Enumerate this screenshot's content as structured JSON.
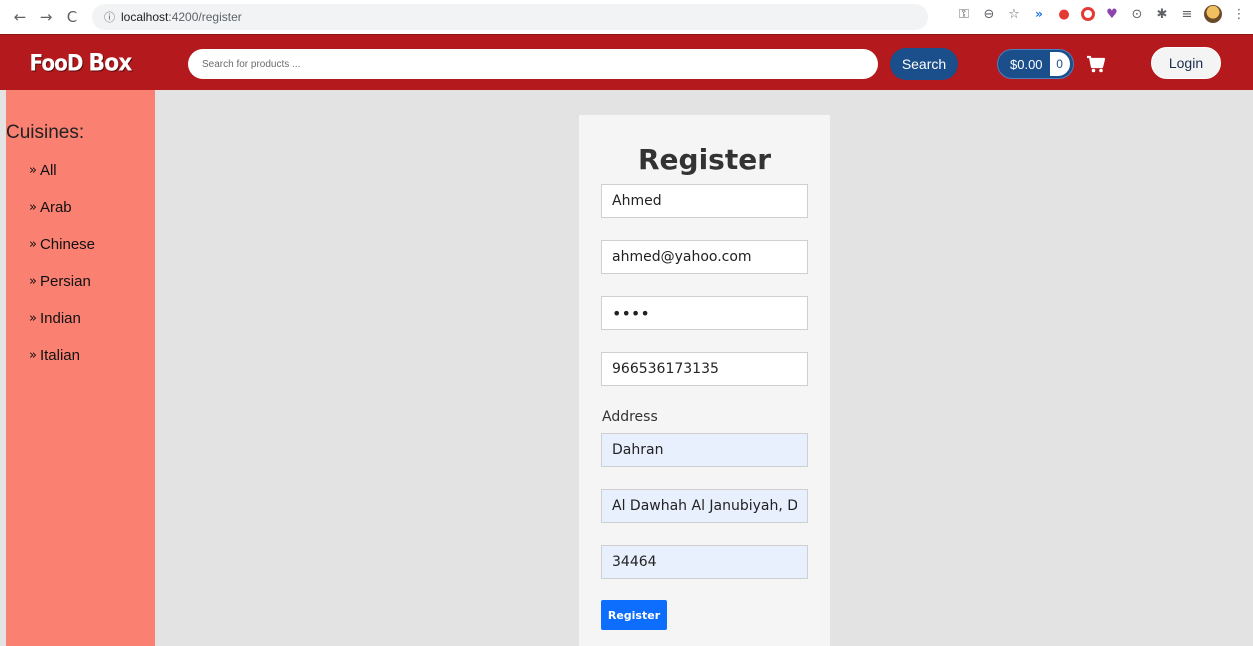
{
  "browser": {
    "back_glyph": "←",
    "forward_glyph": "→",
    "reload_glyph": "C",
    "info_glyph": "ⓘ",
    "url_host": "localhost",
    "url_path": ":4200/register",
    "extension_icons": [
      "key-icon",
      "zoom-icon",
      "star-icon",
      "wave-extension-icon",
      "shield-extension-icon",
      "opera-extension-icon",
      "heart-extension-icon",
      "circle-extension-icon",
      "puzzle-icon",
      "reading-list-icon",
      "profile-avatar",
      "menu-dots-icon"
    ]
  },
  "header": {
    "logo_text": "FooD",
    "logo_sub": "Box",
    "search_placeholder": "Search for products ...",
    "search_label": "Search",
    "cart_total": "$0.00",
    "cart_count": "0",
    "login_label": "Login",
    "colors": {
      "header_bg": "#b3191d",
      "button_blue": "#1b4f8b"
    }
  },
  "sidebar": {
    "title": "Cuisines:",
    "items": [
      {
        "label": "All"
      },
      {
        "label": "Arab"
      },
      {
        "label": "Chinese"
      },
      {
        "label": "Persian"
      },
      {
        "label": "Indian"
      },
      {
        "label": "Italian"
      }
    ],
    "bg_color": "#fa8072"
  },
  "register": {
    "title": "Register",
    "name_value": "Ahmed",
    "email_value": "ahmed@yahoo.com",
    "password_value": "abcd",
    "phone_value": "966536173135",
    "address_label": "Address",
    "city_value": "Dahran",
    "street_value": "Al Dawhah Al Janubiyah, Dhahran",
    "zip_value": "34464",
    "submit_label": "Register",
    "button_color": "#0d6efd"
  }
}
